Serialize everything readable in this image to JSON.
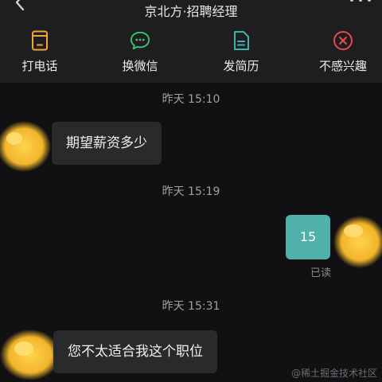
{
  "header": {
    "title": "京北方·招聘经理",
    "actions": [
      {
        "label": "打电话",
        "icon": "phone-icon",
        "color": "#f2a531"
      },
      {
        "label": "换微信",
        "icon": "wechat-icon",
        "color": "#37c46a"
      },
      {
        "label": "发简历",
        "icon": "resume-icon",
        "color": "#3fb4a8"
      },
      {
        "label": "不感兴趣",
        "icon": "not-interested-icon",
        "color": "#e84a4a"
      }
    ]
  },
  "chat": {
    "messages": [
      {
        "time": "昨天 15:10",
        "text": "期望薪资多少",
        "from": "recruiter"
      },
      {
        "time": "昨天 15:19",
        "text": "15",
        "from": "me",
        "status": "已读"
      },
      {
        "time": "昨天 15:31",
        "text": "您不太适合我这个职位",
        "from": "recruiter"
      }
    ]
  },
  "watermark": "@稀土掘金技术社区",
  "colors": {
    "header_bg": "#1e1e20",
    "chat_bg": "#111113",
    "bubble_bg": "#2a2a2d",
    "my_bubble_bg": "#4fb1a9",
    "avatar_blur": "#f2c23a"
  }
}
